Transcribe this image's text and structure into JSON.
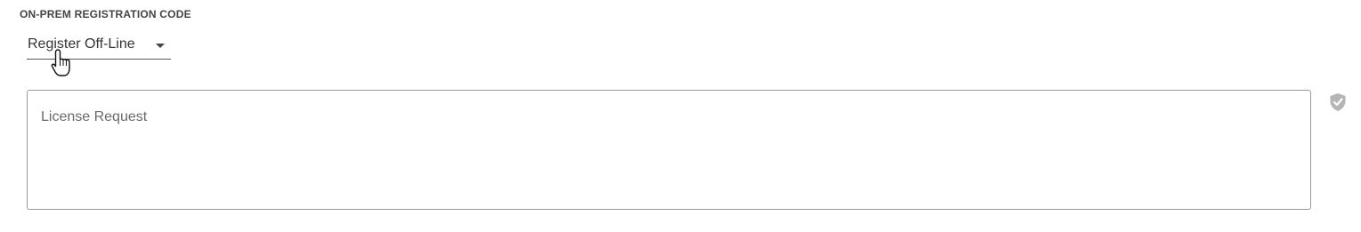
{
  "section": {
    "title": "ON-PREM REGISTRATION CODE"
  },
  "registration_mode": {
    "selected": "Register Off-Line",
    "icon": "caret-down-icon"
  },
  "license_request": {
    "placeholder": "License Request",
    "value": ""
  },
  "status_icon": "shield-check-icon",
  "colors": {
    "text": "#333333",
    "border": "#9a9a9a",
    "icon_gray": "#b5b5b5"
  }
}
